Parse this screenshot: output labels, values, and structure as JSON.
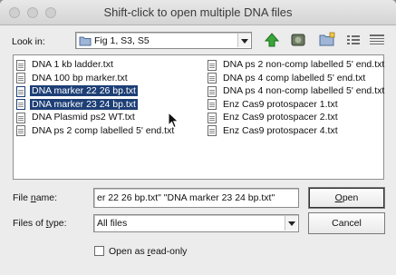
{
  "window": {
    "title": "Shift-click to open multiple DNA files"
  },
  "lookin": {
    "label": "Look in:",
    "value": "Fig 1, S3, S5"
  },
  "toolbar": {
    "icons": [
      "up-arrow-icon",
      "network-icon",
      "new-folder-icon",
      "list-view-icon",
      "details-view-icon"
    ]
  },
  "files": {
    "col1": [
      {
        "name": "DNA 1 kb ladder.txt",
        "selected": false
      },
      {
        "name": "DNA 100 bp marker.txt",
        "selected": false
      },
      {
        "name": "DNA marker 22 26 bp.txt",
        "selected": true
      },
      {
        "name": "DNA marker 23 24 bp.txt",
        "selected": true
      },
      {
        "name": "DNA Plasmid ps2 WT.txt",
        "selected": false
      },
      {
        "name": "DNA ps 2 comp labelled 5' end.txt",
        "selected": false
      }
    ],
    "col2": [
      {
        "name": "DNA ps 2 non-comp labelled 5' end.txt",
        "selected": false
      },
      {
        "name": "DNA ps 4 comp labelled 5' end.txt",
        "selected": false
      },
      {
        "name": "DNA ps 4 non-comp labelled 5' end.txt",
        "selected": false
      },
      {
        "name": "Enz Cas9 protospacer 1.txt",
        "selected": false
      },
      {
        "name": "Enz Cas9 protospacer 2.txt",
        "selected": false
      },
      {
        "name": "Enz Cas9 protospacer 4.txt",
        "selected": false
      }
    ]
  },
  "filename": {
    "label_pre": "File ",
    "label_u": "n",
    "label_post": "ame:",
    "value": "er 22 26 bp.txt\" \"DNA marker 23 24 bp.txt\""
  },
  "filetype": {
    "label_pre": "Files of ",
    "label_u": "t",
    "label_post": "ype:",
    "value": "All files"
  },
  "readonly": {
    "label_pre": "Open as ",
    "label_u": "r",
    "label_post": "ead-only"
  },
  "buttons": {
    "open_u": "O",
    "open_rest": "pen",
    "cancel": "Cancel"
  }
}
